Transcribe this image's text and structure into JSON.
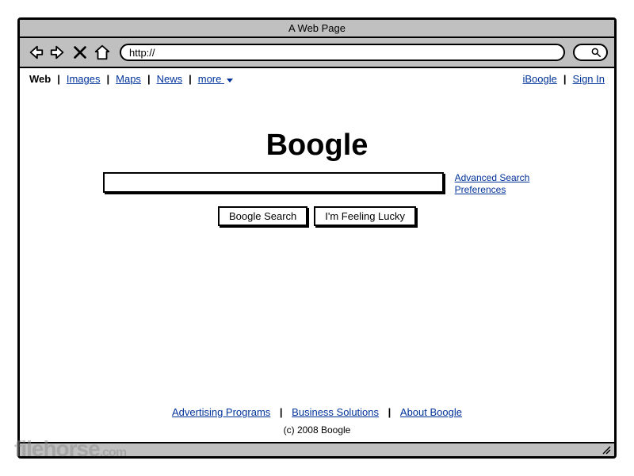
{
  "window": {
    "title": "A Web Page"
  },
  "toolbar": {
    "url": "http://"
  },
  "nav": {
    "web": "Web",
    "images": "Images",
    "maps": "Maps",
    "news": "News",
    "more": "more",
    "iboogle": "iBoogle",
    "signin": "Sign In"
  },
  "main": {
    "logo": "Boogle",
    "search_value": "",
    "advanced": "Advanced Search",
    "preferences": "Preferences",
    "search_btn": "Boogle Search",
    "lucky_btn": "I'm Feeling Lucky"
  },
  "footer": {
    "advertising": "Advertising Programs",
    "business": "Business Solutions",
    "about": "About Boogle",
    "copyright": "(c) 2008 Boogle"
  },
  "watermark": {
    "brand": "filehorse",
    "tld": ".com"
  }
}
